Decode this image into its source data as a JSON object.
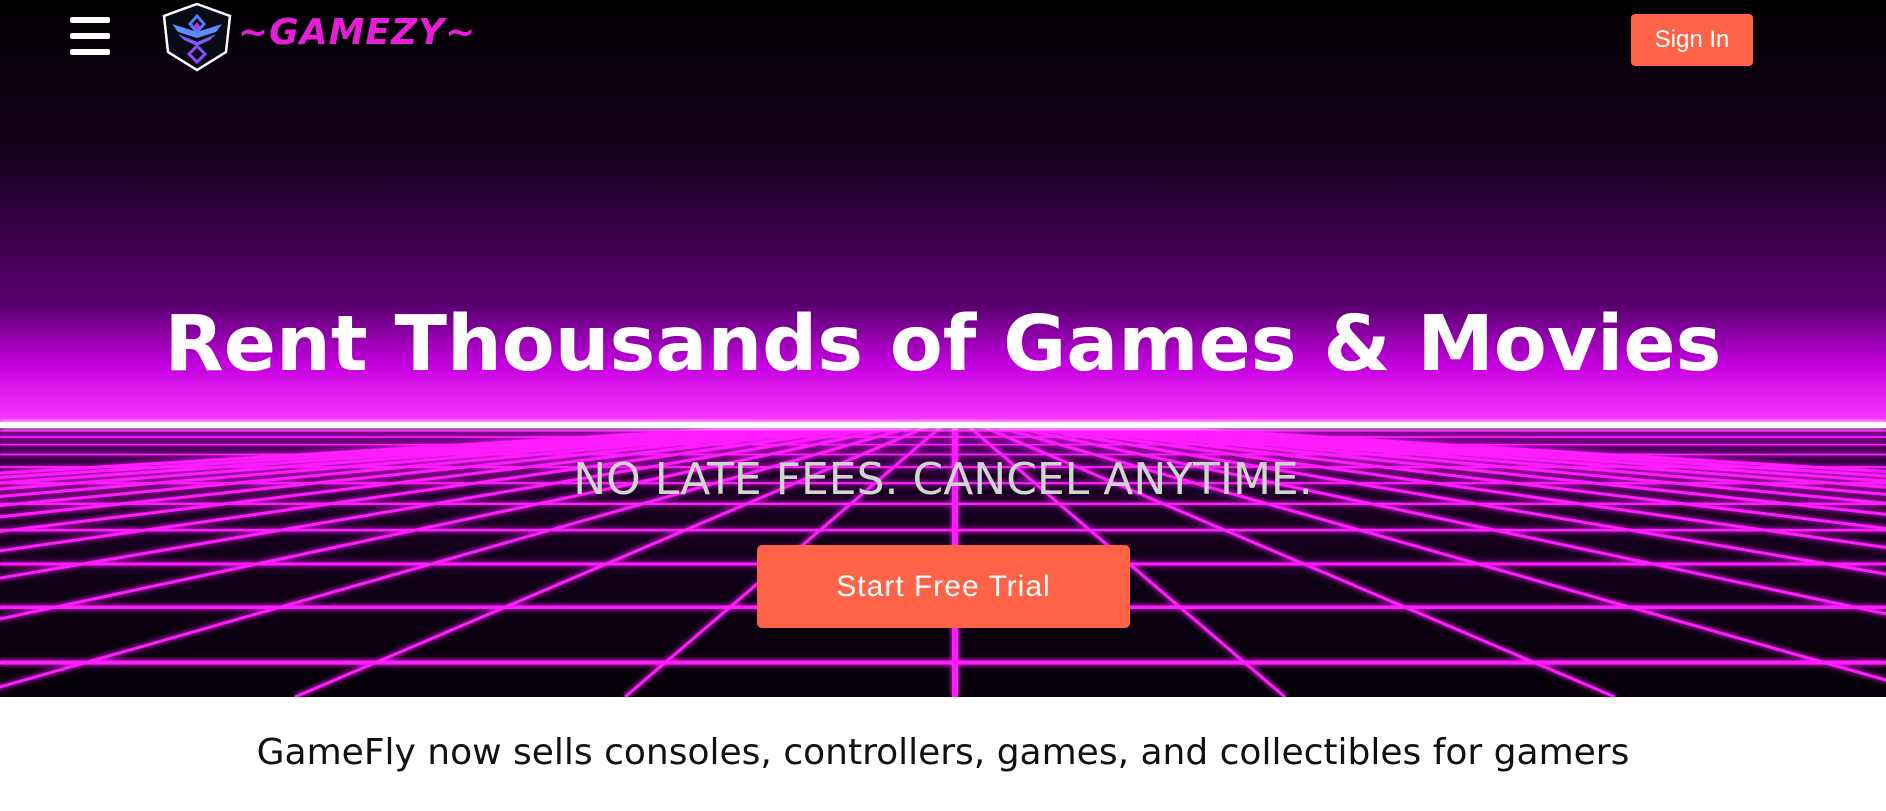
{
  "header": {
    "menu_icon": "hamburger-menu-icon",
    "logo_icon": "winged-shield-icon",
    "logo_text": "~GAMEZY~",
    "sign_in_label": "Sign In"
  },
  "hero": {
    "headline": "Rent Thousands of Games & Movies",
    "subheadline": "NO LATE FEES. CANCEL ANYTIME.",
    "cta_label": "Start Free Trial"
  },
  "below_hero": {
    "tagline": "GameFly now sells consoles, controllers, games, and collectibles for gamers"
  },
  "colors": {
    "accent": "#ff6347",
    "brand_magenta": "#e61fd6",
    "neon_grid": "#ff2bff",
    "hero_background": "#000000"
  }
}
